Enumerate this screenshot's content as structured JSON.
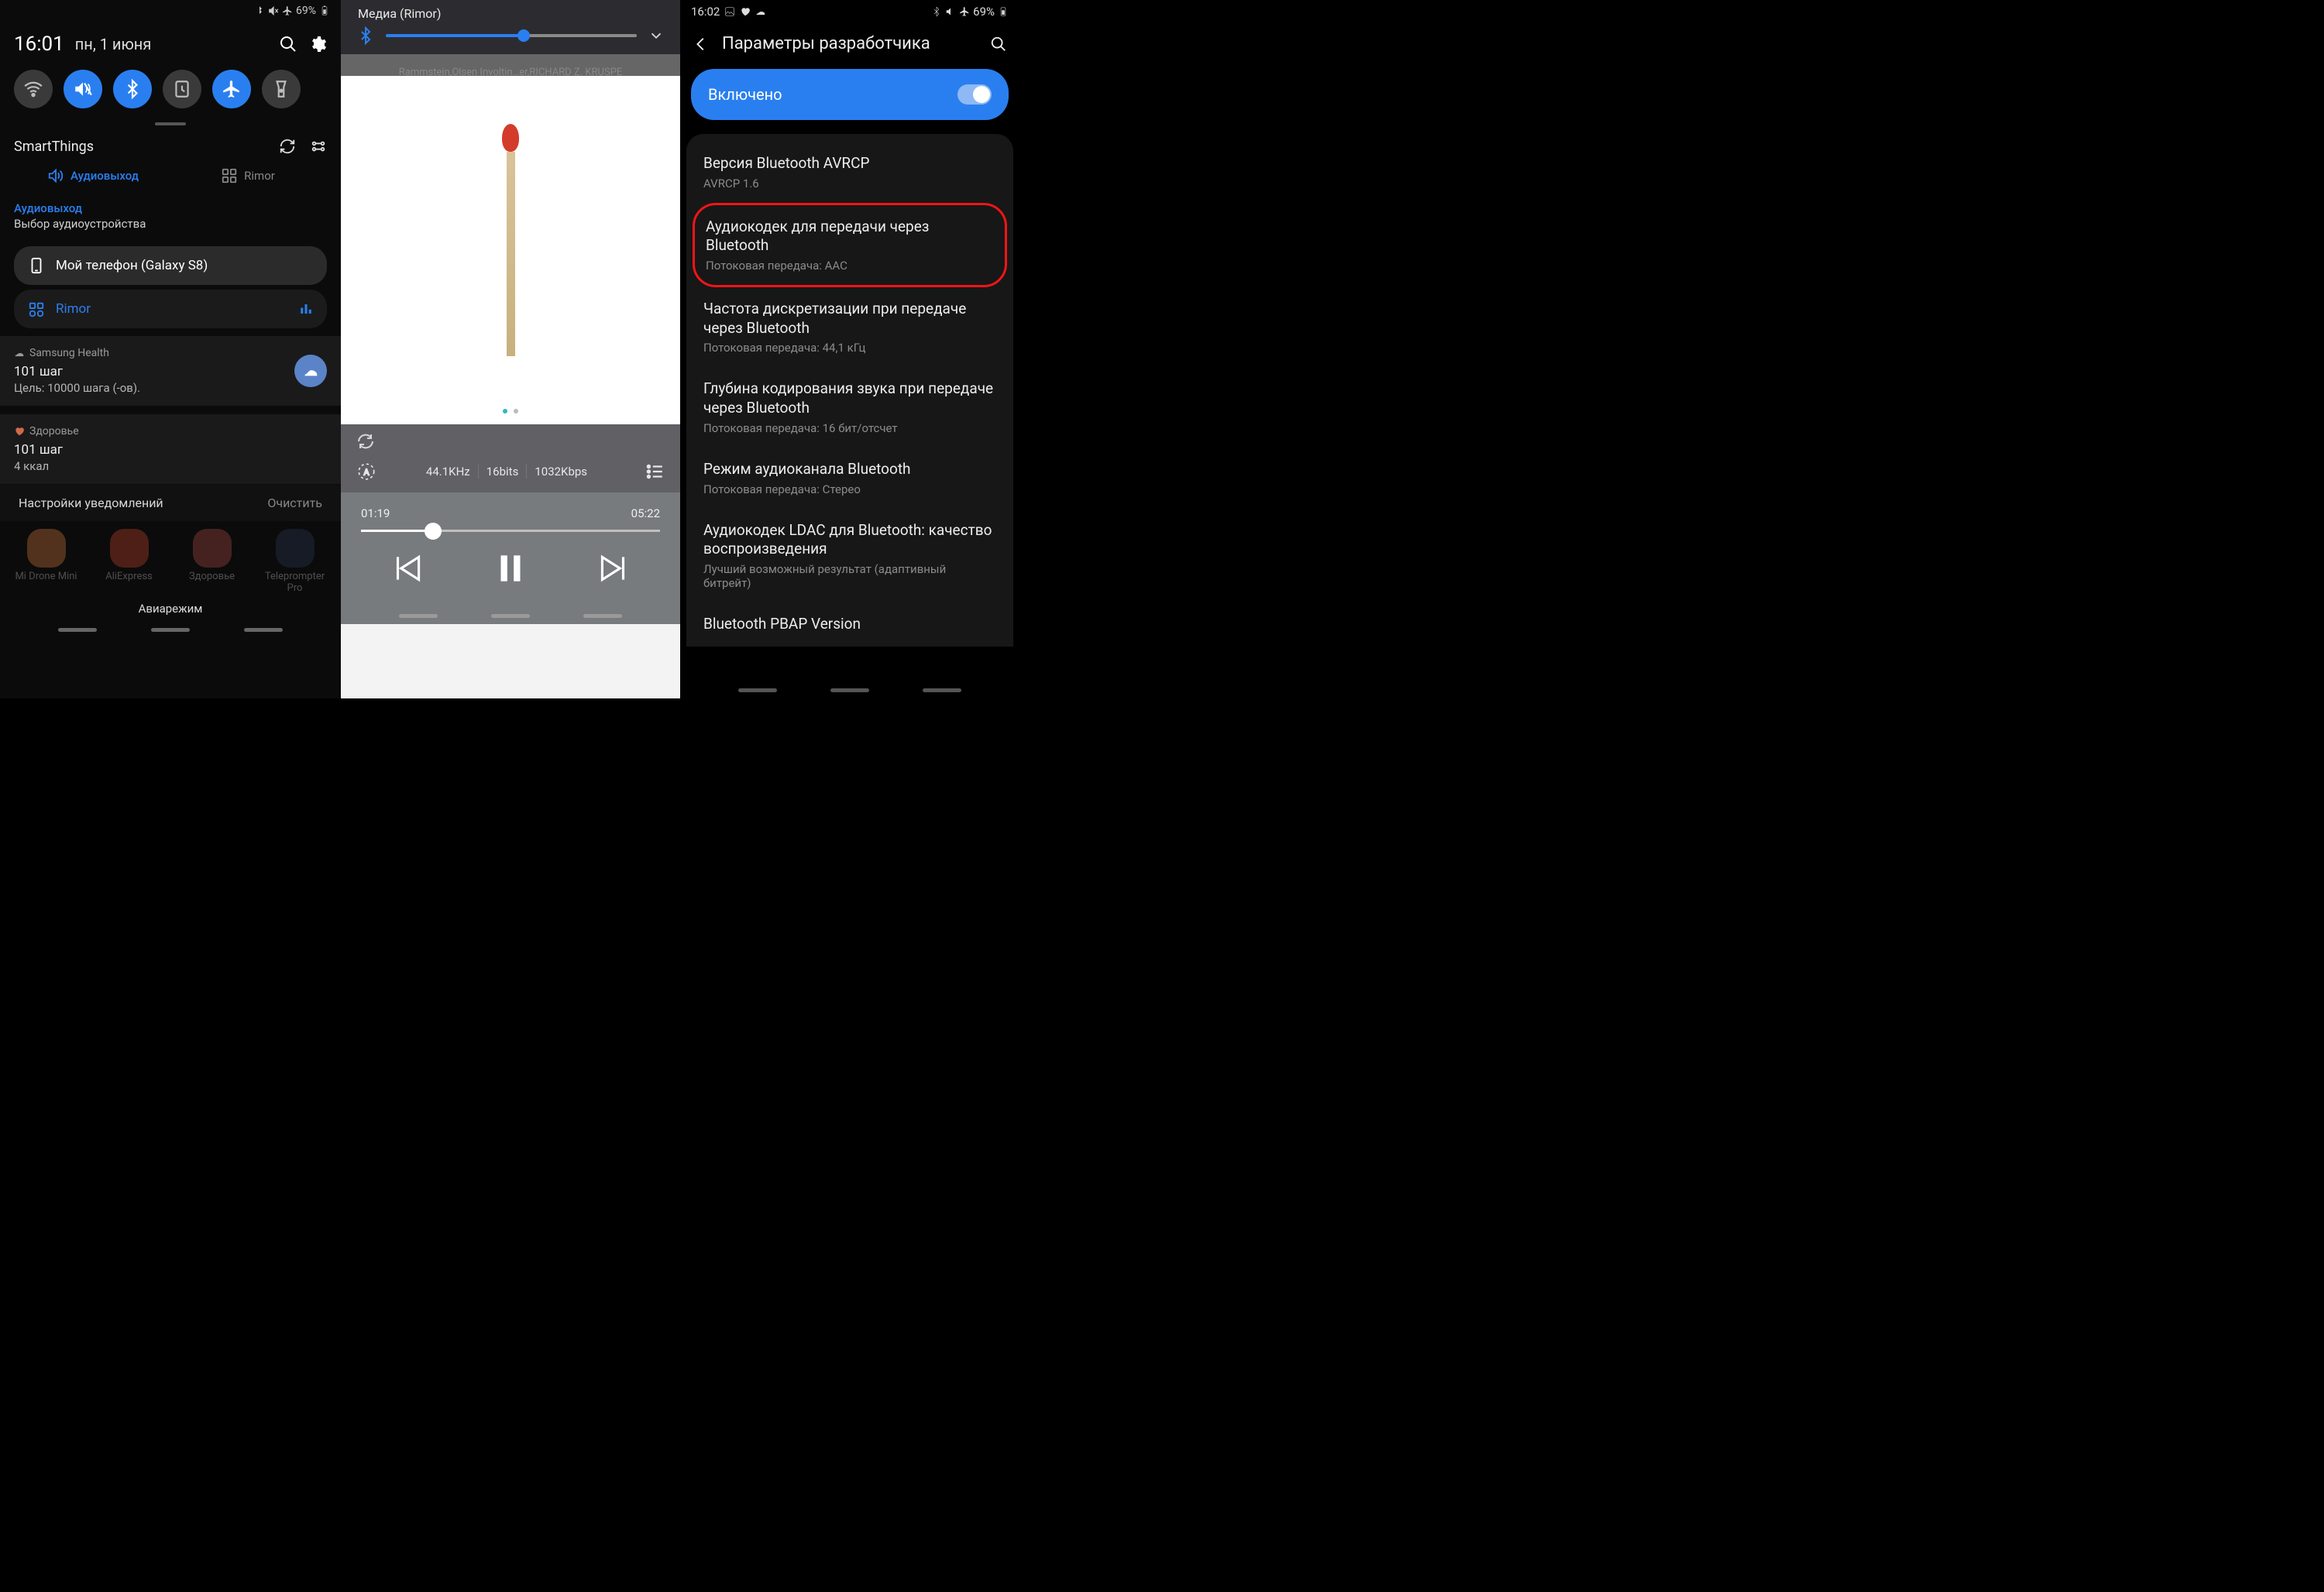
{
  "panel1": {
    "status": {
      "battery": "69%"
    },
    "time": "16:01",
    "date": "пн, 1 июня",
    "smartthings": "SmartThings",
    "tabs": {
      "audio": "Аудиовыход",
      "device": "Rimor"
    },
    "audio": {
      "label": "Аудиовыход",
      "sub": "Выбор аудиоустройства"
    },
    "devices": {
      "phone": "Мой телефон (Galaxy S8)",
      "rimor": "Rimor"
    },
    "notif1": {
      "app": "Samsung Health",
      "title": "101 шаг",
      "sub": "Цель: 10000 шага (-ов)."
    },
    "notif2": {
      "app": "Здоровье",
      "title": "101 шаг",
      "sub": "4 ккал"
    },
    "actions": {
      "settings": "Настройки уведомлений",
      "clear": "Очистить"
    },
    "apps": [
      "Mi Drone Mini",
      "AliExpress",
      "Здоровье",
      "Teleprompter Pro"
    ],
    "avia": "Авиарежим"
  },
  "panel2": {
    "overlay_title": "Медиа (Rimor)",
    "track": "Rammstein,Olsen Involtin…er,RICHARD Z. KRUSPE",
    "info": {
      "freq": "44.1KHz",
      "bits": "16bits",
      "rate": "1032Kbps"
    },
    "time": {
      "cur": "01:19",
      "total": "05:22"
    }
  },
  "panel3": {
    "status": {
      "time": "16:02",
      "battery": "69%"
    },
    "title": "Параметры разработчика",
    "enabled": "Включено",
    "items": [
      {
        "t": "Версия Bluetooth AVRCP",
        "s": "AVRCP 1.6"
      },
      {
        "t": "Аудиокодек для передачи через Bluetooth",
        "s": "Потоковая передача: AAC"
      },
      {
        "t": "Частота дискретизации при передаче через Bluetooth",
        "s": "Потоковая передача: 44,1 кГц"
      },
      {
        "t": "Глубина кодирования звука при передаче через Bluetooth",
        "s": "Потоковая передача: 16 бит/отсчет"
      },
      {
        "t": "Режим аудиоканала Bluetooth",
        "s": "Потоковая передача: Стерео"
      },
      {
        "t": "Аудиокодек LDAC для Bluetooth: качество воспроизведения",
        "s": "Лучший возможный результат (адаптивный битрейт)"
      },
      {
        "t": "Bluetooth PBAP Version",
        "s": ""
      }
    ]
  }
}
